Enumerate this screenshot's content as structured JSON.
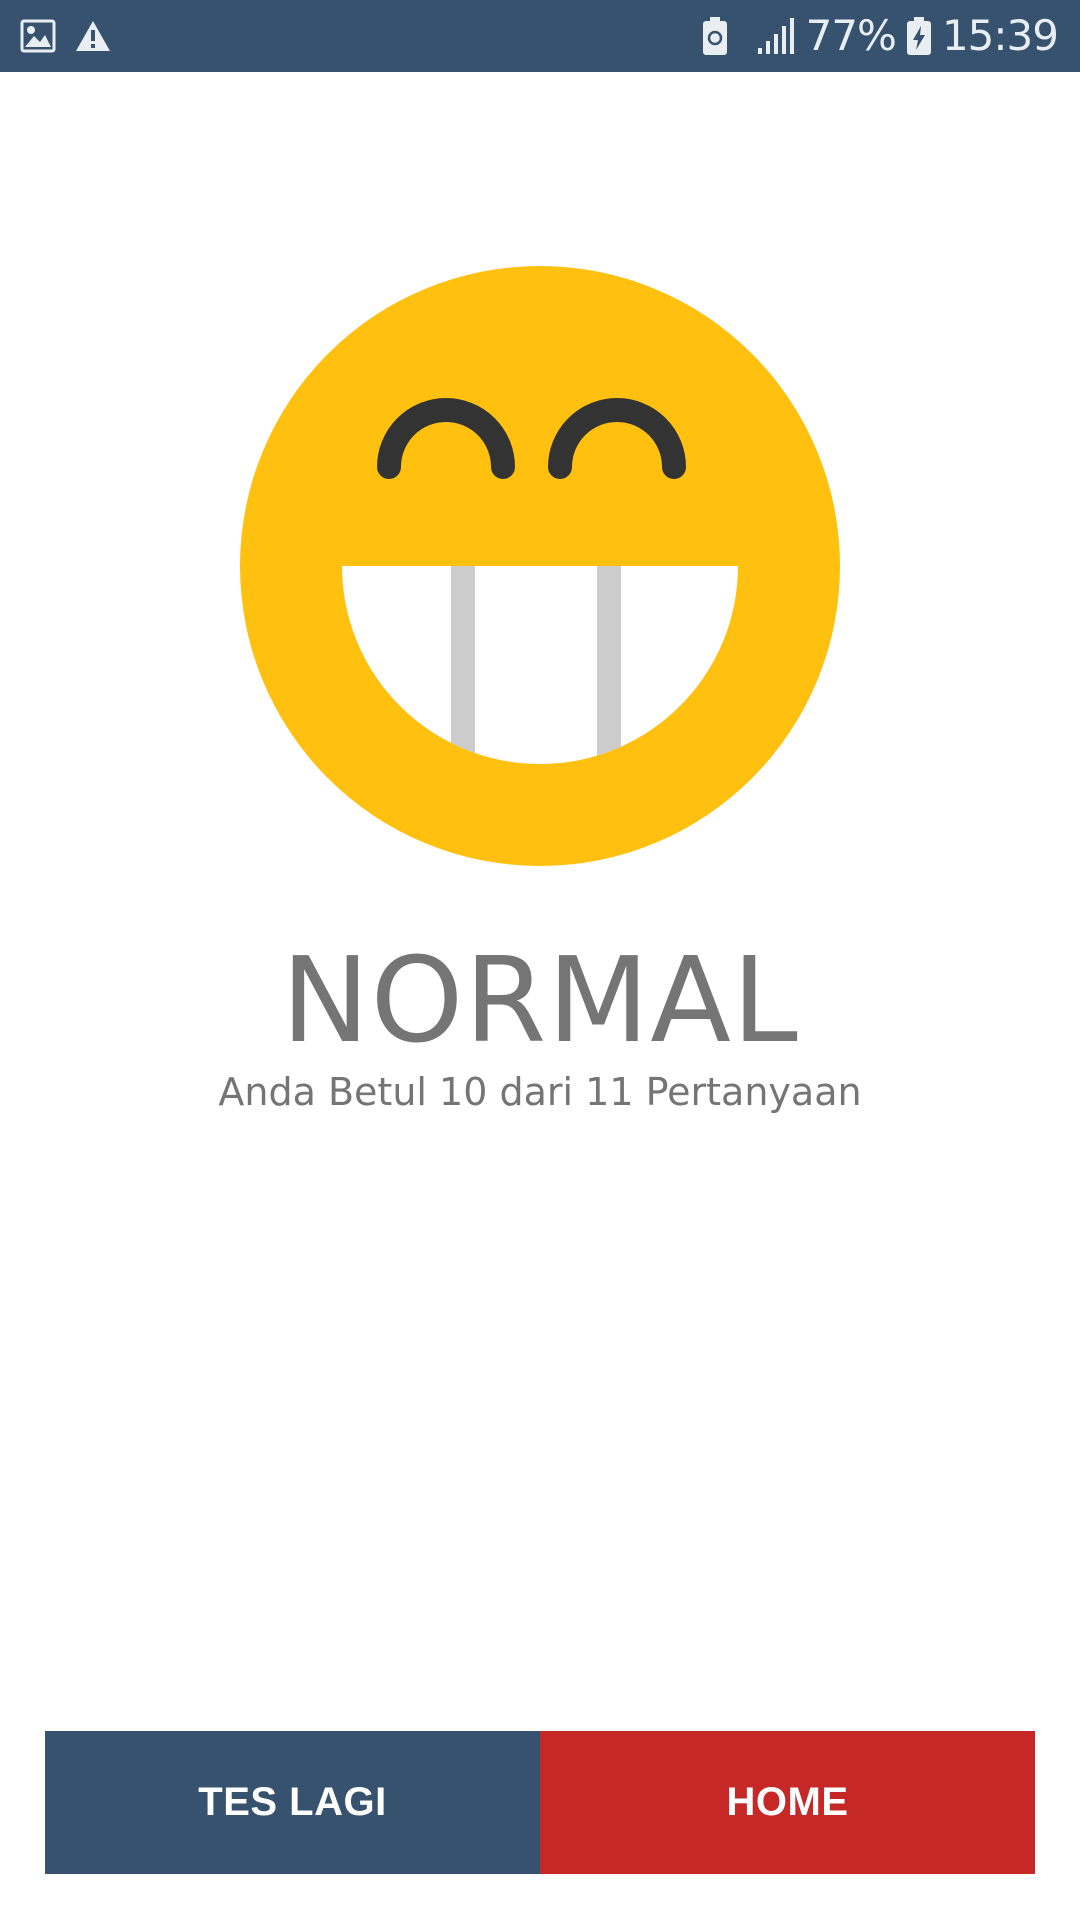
{
  "status_bar": {
    "battery_percent": "77%",
    "time": "15:39",
    "icons": [
      "gallery-icon",
      "warning-icon",
      "battery-saver-icon",
      "signal-icon",
      "battery-charging-icon"
    ]
  },
  "result": {
    "emoji": "grinning-face-icon",
    "title": "NORMAL",
    "subtitle": "Anda Betul 10 dari 11 Pertanyaan"
  },
  "buttons": {
    "retry_label": "TES LAGI",
    "home_label": "HOME"
  },
  "colors": {
    "primary": "#37526f",
    "accent": "#c62828",
    "emoji_face": "#ffc010",
    "text_gray": "#757575"
  }
}
